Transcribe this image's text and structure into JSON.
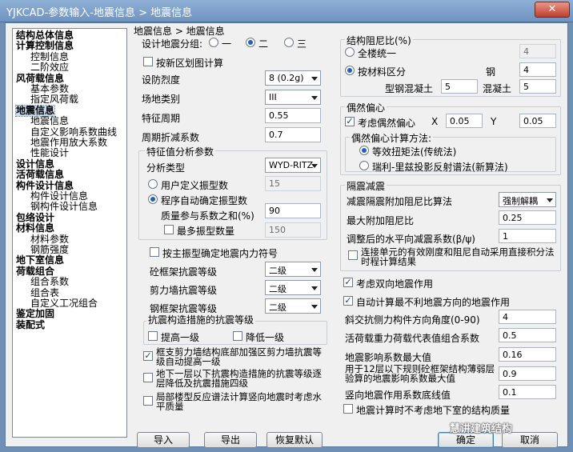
{
  "window": {
    "title": "YJKCAD-参数输入-地震信息 > 地震信息",
    "close": "✕"
  },
  "tree": [
    {
      "label": "结构总体信息",
      "bold": true,
      "indent": 0
    },
    {
      "label": "计算控制信息",
      "bold": true,
      "indent": 0
    },
    {
      "label": "控制信息",
      "bold": false,
      "indent": 1
    },
    {
      "label": "二阶效应",
      "bold": false,
      "indent": 1
    },
    {
      "label": "风荷载信息",
      "bold": true,
      "indent": 0
    },
    {
      "label": "基本参数",
      "bold": false,
      "indent": 1
    },
    {
      "label": "指定风荷载",
      "bold": false,
      "indent": 1
    },
    {
      "label": "地震信息",
      "bold": true,
      "indent": 0,
      "selected": true
    },
    {
      "label": "地震信息",
      "bold": false,
      "indent": 1
    },
    {
      "label": "自定义影响系数曲线",
      "bold": false,
      "indent": 1
    },
    {
      "label": "地震作用放大系数",
      "bold": false,
      "indent": 1
    },
    {
      "label": "性能设计",
      "bold": false,
      "indent": 1
    },
    {
      "label": "设计信息",
      "bold": true,
      "indent": 0
    },
    {
      "label": "活荷载信息",
      "bold": true,
      "indent": 0
    },
    {
      "label": "构件设计信息",
      "bold": true,
      "indent": 0
    },
    {
      "label": "构件设计信息",
      "bold": false,
      "indent": 1
    },
    {
      "label": "钢构件设计信息",
      "bold": false,
      "indent": 1
    },
    {
      "label": "包络设计",
      "bold": true,
      "indent": 0
    },
    {
      "label": "材料信息",
      "bold": true,
      "indent": 0
    },
    {
      "label": "材料参数",
      "bold": false,
      "indent": 1
    },
    {
      "label": "钢筋强度",
      "bold": false,
      "indent": 1
    },
    {
      "label": "地下室信息",
      "bold": true,
      "indent": 0
    },
    {
      "label": "荷载组合",
      "bold": true,
      "indent": 0
    },
    {
      "label": "组合系数",
      "bold": false,
      "indent": 1
    },
    {
      "label": "组合表",
      "bold": false,
      "indent": 1
    },
    {
      "label": "自定义工况组合",
      "bold": false,
      "indent": 1
    },
    {
      "label": "鉴定加固",
      "bold": true,
      "indent": 0
    },
    {
      "label": "装配式",
      "bold": true,
      "indent": 0
    }
  ],
  "breadcrumb": "地震信息 > 地震信息",
  "left": {
    "group_label": "设计地震分组:",
    "group_opts": [
      "一",
      "二",
      "三"
    ],
    "new_zoning": "按新区划图计算",
    "intensity_label": "设防烈度",
    "intensity": "8 (0.2g)",
    "site_label": "场地类别",
    "site": "III",
    "tg_label": "特征周期",
    "tg": "0.55",
    "period_label": "周期折减系数",
    "period": "0.7",
    "eig_group": "特征值分析参数",
    "analysis_label": "分析类型",
    "analysis": "WYD-RITZ",
    "user_modes": "用户定义振型数",
    "user_modes_val": "15",
    "auto_modes": "程序自动确定振型数",
    "mass_label": "质量参与系数之和(%)",
    "mass": "90",
    "max_modes": "最多振型数量",
    "max_modes_val": "150",
    "main_mode_sign": "按主振型确定地震内力符号",
    "frame_grade_label": "砼框架抗震等级",
    "frame_grade": "二级",
    "wall_grade_label": "剪力墙抗震等级",
    "wall_grade": "二级",
    "steel_grade_label": "钢框架抗震等级",
    "steel_grade": "二级",
    "cm_group": "抗震构造措施的抗震等级",
    "cm_up": "提高一级",
    "cm_down": "降低一级",
    "opt1": "框支剪力墙结构底部加强区剪力墙抗震等级自动提高一级",
    "opt2": "地下一层以下抗震构造措施的抗震等级逐层降低及抗震措施四级",
    "opt3": "局部楼型反应谱法计算竖向地震时考虑水平质量"
  },
  "right": {
    "damp_group": "结构阻尼比(%)",
    "all_same": "全楼统一",
    "all_same_val": "4",
    "by_mat": "按材料区分",
    "steel_label": "钢",
    "steel": "4",
    "src_label": "型钢混凝土",
    "src": "5",
    "conc_label": "混凝土",
    "conc": "5",
    "ecc_group": "偶然偏心",
    "ecc_chk": "考虑偶然偏心",
    "x_label": "X",
    "x": "0.05",
    "y_label": "Y",
    "y": "0.05",
    "ecc_method": "偶然偏心计算方法:",
    "ecc_m1": "等效扭矩法(传统法)",
    "ecc_m2": "瑞利-里兹投影反射谱法(新算法)",
    "iso_group": "隔震减震",
    "iso_method_label": "减震隔震附加阻尼比算法",
    "iso_method": "强制解耦",
    "max_damp_label": "最大附加阻尼比",
    "max_damp": "0.25",
    "adj_label": "调整后的水平向减震系数(β/ψ)",
    "adj": "1",
    "conn_opt": "连接单元的有效刚度和阻尼自动采用直接积分法时程计算结果",
    "bidir": "考虑双向地震作用",
    "worst": "自动计算最不利地震方向的地震作用",
    "oblique_label": "斜交抗侧力构件方向角度(0-90)",
    "oblique": "4",
    "live_label": "活荷载重力荷载代表值组合系数",
    "live": "0.5",
    "alpha_label": "地震影响系数最大值",
    "alpha": "0.16",
    "rare_label": "用于12层以下规则砼框架结构薄弱层验算的地震影响系数最大值",
    "rare": "0.9",
    "vert_label": "竖向地震作用系数底线值",
    "vert": "0.1",
    "basement": "地震计算时不考虑地下室的结构质量"
  },
  "buttons": {
    "import": "导入",
    "export": "导出",
    "restore": "恢复默认",
    "ok": "确定",
    "cancel": "取消"
  },
  "watermark": "慧讲建筑结构"
}
